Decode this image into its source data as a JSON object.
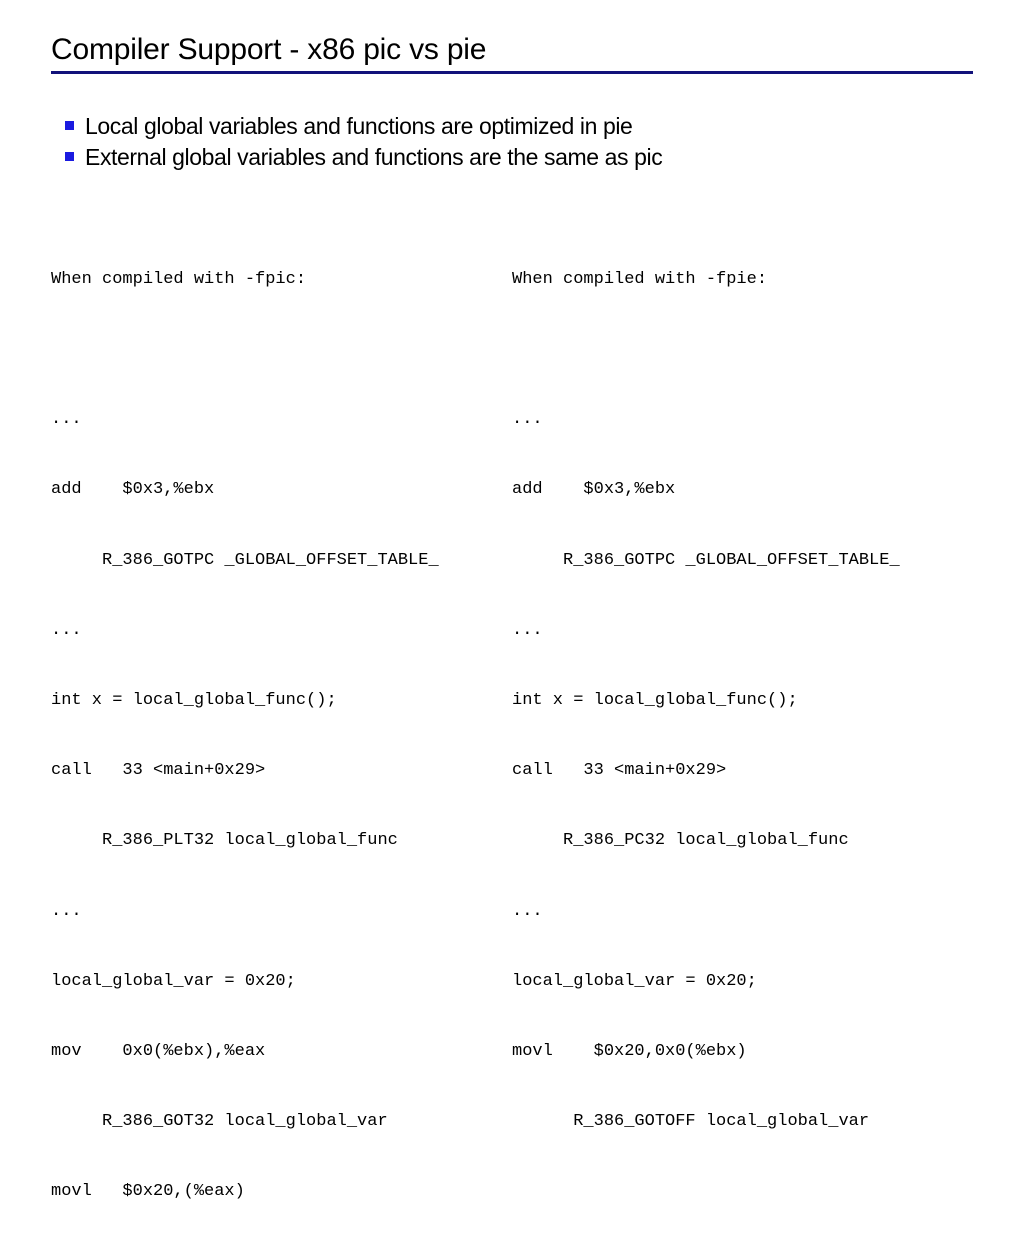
{
  "slide": {
    "title": "Compiler Support - x86 pic vs pie",
    "rule_color": "#12127a",
    "bullet_color": "#1a1ae0",
    "background_color": "#ffffff",
    "text_color": "#000000"
  },
  "bullets": [
    {
      "marker": "square-bullet",
      "text": "Local global variables and functions are optimized in pie"
    },
    {
      "marker": "square-bullet",
      "text": "External global variables and functions are the same as pic"
    }
  ],
  "code_columns": [
    {
      "id": "pic-column",
      "heading": "When compiled with -fpic:",
      "lines": [
        "When compiled with -fpic:",
        "",
        "...",
        "add    $0x3,%ebx",
        "     R_386_GOTPC _GLOBAL_OFFSET_TABLE_",
        "...",
        "int x = local_global_func();",
        "call   33 <main+0x29>",
        "     R_386_PLT32 local_global_func",
        "...",
        "local_global_var = 0x20;",
        "mov    0x0(%ebx),%eax",
        "     R_386_GOT32 local_global_var",
        "movl   $0x20,(%eax)"
      ]
    },
    {
      "id": "pie-column",
      "heading": "When compiled with -fpie:",
      "lines": [
        "When compiled with -fpie:",
        "",
        "...",
        "add    $0x3,%ebx",
        "     R_386_GOTPC _GLOBAL_OFFSET_TABLE_",
        "...",
        "int x = local_global_func();",
        "call   33 <main+0x29>",
        "     R_386_PC32 local_global_func",
        "...",
        "local_global_var = 0x20;",
        "movl    $0x20,0x0(%ebx)",
        "      R_386_GOTOFF local_global_var"
      ]
    }
  ]
}
